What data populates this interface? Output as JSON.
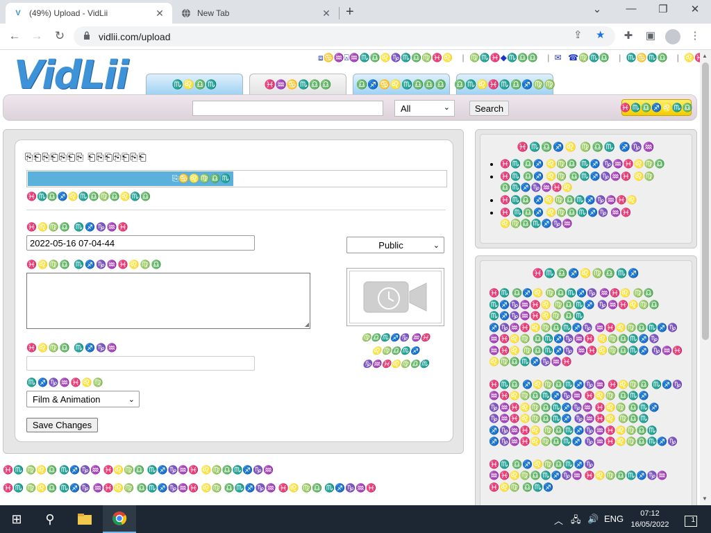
{
  "browser": {
    "tabs": [
      {
        "title": "(49%) Upload - VidLii",
        "favicon": "V"
      },
      {
        "title": "New Tab",
        "favicon": "globe-icon"
      }
    ],
    "new_tab_glyph": "+",
    "close_glyph": "✕",
    "window": {
      "minimize": "⌄",
      "min": "—",
      "restore": "❐",
      "close": "✕"
    },
    "url": "vidlii.com/upload",
    "nav": {
      "back": "←",
      "forward": "→",
      "reload": "↻",
      "lock": "🔒"
    }
  },
  "site": {
    "logo": "VidLii",
    "top_links": [
      "⧈♋♒⍓♒♏♎♌♑♏♎♍♓♌",
      "♍♏♓◆♏♎♎",
      "☎︎♍♏♎",
      "♏♋♏♎",
      "♌♓♎♍",
      "♐♋♏♎"
    ],
    "nav_tabs": [
      "♏♌♎♏",
      "♓♒♋♏♎♎",
      "♎♐♋♌♏♎♎♎",
      "♎♏♌♓♏♎♐♍♍"
    ],
    "search": {
      "placeholder": "",
      "category": "All",
      "button": "Search"
    },
    "upload_button": "♓♏♎♐♌♏♎"
  },
  "upload": {
    "section_title": "⎘⎗⎘⎗⎘⎗⎘ ⎗⎘⎗⎘⎗⎘⎗",
    "progress_pct": 49,
    "progress_label": "⎘♋♌♍♎♏",
    "status": "♓♏♎♐♌♏♎♍♎♌♏♎",
    "title_label": "♓♌♍♎ ♏♐♑♒♓",
    "title_value": "2022-05-16 07-04-44",
    "description_label": "♓♌♍♎ ♏♐♑♒♓♌♍♎",
    "tags_label": "♓♌♍♎ ♏♐♑♒",
    "category_label": "♏♐♑♒♓♌♍",
    "category_value": "Film & Animation",
    "privacy_value": "Public",
    "thumb_caption": [
      "♍♎♏♐♑ ♒♓",
      "♌♍♎♏♐",
      "♑♒♓♌♍♎♏"
    ],
    "save_button": "Save Changes"
  },
  "footer_notes": [
    {
      "text": "♓♏ ♍♌♎ ♏♐♑♒ ♓♌♍♎ ♏♐♑♒♓ ♌♍♎♏♐♑♒",
      "link": ""
    },
    {
      "text": "♓♏ ♍♌♎ ♏♐♑",
      "link": "♒♓♌♍ ♎♏♐♑♒♓",
      "tail": "♌♍ ♎♏♐♑♒ ♓♌ ♍♎ ♏♐♑♒♓"
    }
  ],
  "sidebar": {
    "box1": {
      "title": "♓♏♎♐♌ ♍♎♏ ♐♑♒",
      "items": [
        "♓♏ ♎♐ ♌♍♎ ♏♐ ♑♒♓♌♍♎",
        "♓♏ ♎♐ ♌♍ ♎♏♐♑♒♓ ♌♍ ♎♏♐♑♒♓♌",
        "♓♏♎ ♐♌♍♎♏♐♑♒♓♌",
        "♓ ♏♎♐ ♌♍♎♏♐♑ ♒♓ ♌♍♎♏♐♑♒"
      ]
    },
    "box2": {
      "title": "♓♏♎♐♌♍♎♏♐",
      "para1": "♓♏ ♎♐♌ ♍♎♏♐♑ ♒♓♌ ♍♎ ♏♐♑♒♓♌ ♍♎♏♐ ♑♒♓♌♍♎ ♏♐♑♒♓♌♍ ♎♏ ♐♑♒♓♌♍♎♏♐♑ ♒♓♌♍♎♏♐♑ ♒♓♌♍ ♎♏♐♑♒♓ ♌♍♎♏♐♑ ♒♓♌ ♍♎♏♐♑ ♒♓♌♍♎♏♐ ♑♒♓ ♌♍♎♏♐♑♒♓",
      "para2": "♓♏♎ ♐♌♍♎♏♐♑♒ ♓♌♍♎ ♏♐♑ ♒♓♌♍♎♏♐♑♒ ♓♌♍ ♎♏♐ ♑♒♓♌♍♎♏♐♑♒ ♓♌♍ ♎♏♐ ♑♒♓♌♍♎♏♐ ♑♒♓♌ ♍♎♏ ♐♑♒♓♌ ♍♎♏♐♑♒♓♌♍♎♏ ♐♑♒♓♌♍♎♏♐ ♑♒♓♌♍♎♏♐♑",
      "para3": "♓♏ ♎♐♌♍♎♏♐♑ ♒♓♌♍♎♏♐♑♒ ♓♌♍♎♏♐♑♒ ♓♌♍ ♎♏♐"
    }
  },
  "taskbar": {
    "start": "⊞",
    "search": "⚲",
    "language": "ENG",
    "time": "07:12",
    "date": "16/05/2022",
    "notifications": "1",
    "tray_up": "︿"
  },
  "colors": {
    "accent": "#3e92d8",
    "progress": "#5bb0dc",
    "upload_btn": "#f2cc00",
    "link": "#1c34c5"
  }
}
